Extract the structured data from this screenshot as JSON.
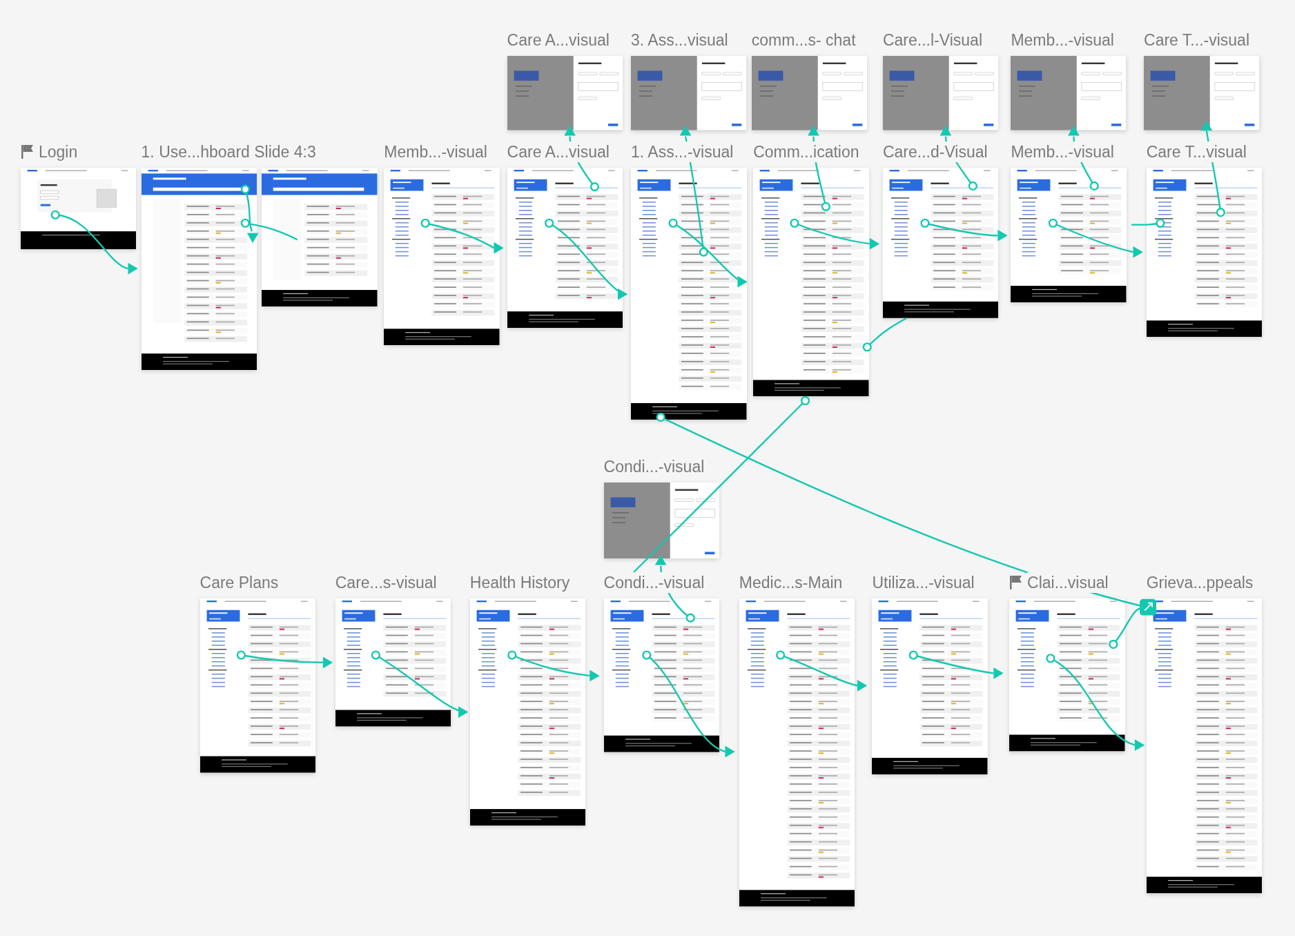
{
  "canvas": {
    "frames": [
      {
        "title": "Care A...visual",
        "kind": "modal",
        "start_flag": false
      },
      {
        "title": "3. Ass...visual",
        "kind": "modal",
        "start_flag": false
      },
      {
        "title": "comm...s- chat",
        "kind": "modal",
        "start_flag": false
      },
      {
        "title": "Care...l-Visual",
        "kind": "modal",
        "start_flag": false
      },
      {
        "title": "Memb...-visual",
        "kind": "modal",
        "start_flag": false
      },
      {
        "title": "Care T...-visual",
        "kind": "modal",
        "start_flag": false
      },
      {
        "title": "Login",
        "kind": "login",
        "start_flag": true
      },
      {
        "title": "1. Use...hboard Slide 4:3",
        "kind": "banner",
        "start_flag": false
      },
      {
        "kind": "banner",
        "start_flag": false
      },
      {
        "title": "Memb...-visual",
        "kind": "detail",
        "start_flag": false
      },
      {
        "title": "Care A...visual",
        "kind": "detail",
        "start_flag": false
      },
      {
        "title": "1. Ass...-visual",
        "kind": "detail",
        "start_flag": false
      },
      {
        "title": "Comm...ication",
        "kind": "detail",
        "start_flag": false
      },
      {
        "title": "Care...d-Visual",
        "kind": "detail",
        "start_flag": false
      },
      {
        "title": "Memb...-visual",
        "kind": "detail",
        "start_flag": false
      },
      {
        "title": "Care T...visual",
        "kind": "detail",
        "start_flag": false
      },
      {
        "title": "Condi...-visual",
        "kind": "modal",
        "start_flag": false
      },
      {
        "title": "Care Plans",
        "kind": "detail",
        "start_flag": false
      },
      {
        "title": "Care...s-visual",
        "kind": "detail",
        "start_flag": false
      },
      {
        "title": "Health History",
        "kind": "detail",
        "start_flag": false
      },
      {
        "title": "Condi...-visual",
        "kind": "detail",
        "start_flag": false
      },
      {
        "title": "Medic...s-Main",
        "kind": "detail",
        "start_flag": false
      },
      {
        "title": "Utiliza...-visual",
        "kind": "detail",
        "start_flag": false
      },
      {
        "title": "Clai...visual",
        "kind": "detail",
        "start_flag": true
      },
      {
        "title": "Grieva...ppeals",
        "kind": "detail",
        "start_flag": false
      }
    ]
  }
}
